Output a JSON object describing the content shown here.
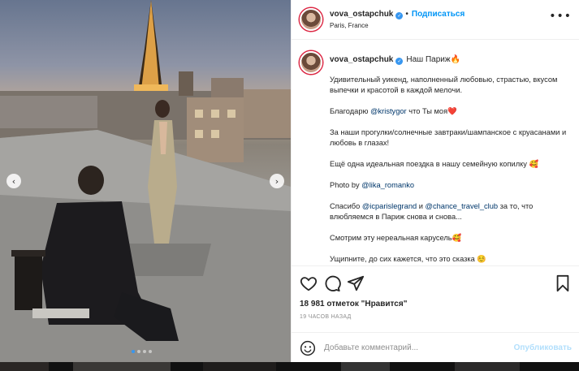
{
  "post": {
    "username": "vova_ostapchuk",
    "verified_glyph": "✓",
    "follow_label": "Подписаться",
    "location": "Paris, France",
    "more_label": "•••"
  },
  "caption": {
    "username": "vova_ostapchuk",
    "headline": "Наш Париж🔥",
    "paragraphs": [
      {
        "parts": [
          {
            "text": "Удивительный уикенд, наполненный любовью, страстью, вкусом выпечки и красотой в каждой мелочи."
          }
        ]
      },
      {
        "parts": [
          {
            "text": "Благодарю "
          },
          {
            "text": "@kristygor",
            "mention": true
          },
          {
            "text": " что Ты моя❤️"
          }
        ]
      },
      {
        "parts": [
          {
            "text": "За наши прогулки/солнечные завтраки/шампанское с круасанами и любовь в глазах!"
          }
        ]
      },
      {
        "parts": [
          {
            "text": "Ещё одна идеальная поездка в нашу семейную копилку 🥰"
          }
        ]
      },
      {
        "parts": [
          {
            "text": "Photo by "
          },
          {
            "text": "@lika_romanko",
            "mention": true
          }
        ]
      },
      {
        "parts": [
          {
            "text": "Спасибо "
          },
          {
            "text": "@icparislegrand",
            "mention": true
          },
          {
            "text": " и "
          },
          {
            "text": "@chance_travel_club",
            "mention": true
          },
          {
            "text": " за то, что влюбляемся в Париж снова и снова..."
          }
        ]
      },
      {
        "parts": [
          {
            "text": "Смотрим эту нереальная карусель🥰"
          }
        ]
      },
      {
        "parts": [
          {
            "text": "Ущипните, до сих кажется, что это сказка ☺️"
          }
        ]
      }
    ]
  },
  "actions": {
    "like_icon": "heart-icon",
    "comment_icon": "comment-icon",
    "share_icon": "share-icon",
    "save_icon": "bookmark-icon"
  },
  "stats": {
    "likes": "18 981 отметок \"Нравится\"",
    "time_ago": "19 ЧАСОВ НАЗАД"
  },
  "comment": {
    "placeholder": "Добавьте комментарий...",
    "post_label": "Опубликовать"
  },
  "carousel": {
    "slide_count": 4,
    "active_index": 0,
    "prev_glyph": "‹",
    "next_glyph": "›"
  },
  "colors": {
    "accent": "#0095f6",
    "verified": "#3897f0",
    "mention": "#00376b",
    "muted": "#8e8e8e"
  }
}
